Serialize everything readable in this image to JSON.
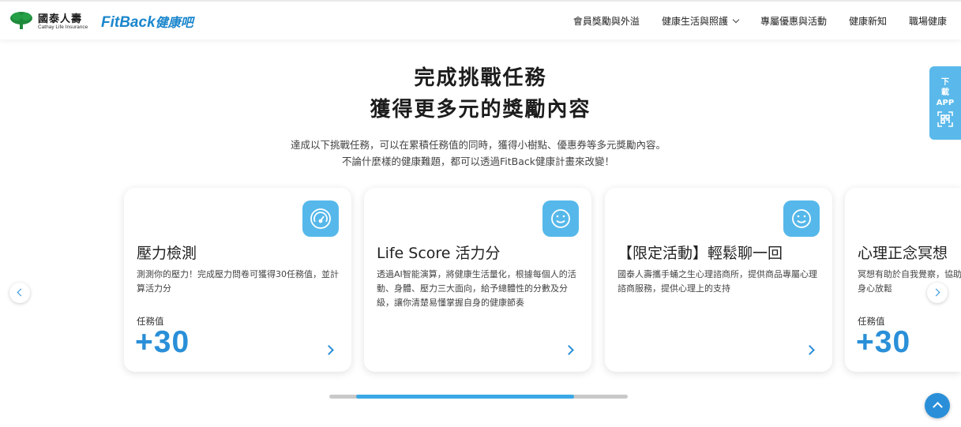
{
  "header": {
    "brand_name": "國泰人壽",
    "brand_sub": "Cathay Life Insurance",
    "fitback_en": "FitBack",
    "fitback_zh": "健康吧",
    "nav": [
      {
        "label": "會員獎勵與外溢"
      },
      {
        "label": "健康生活與照護"
      },
      {
        "label": "專屬優惠與活動"
      },
      {
        "label": "健康新知"
      },
      {
        "label": "職場健康"
      }
    ]
  },
  "hero": {
    "title_line1": "完成挑戰任務",
    "title_line2": "獲得更多元的獎勵內容",
    "desc_line1": "達成以下挑戰任務，可以在累積任務值的同時，獲得小樹點、優惠券等多元獎勵內容。",
    "desc_line2": "不論什麼樣的健康難題，都可以透過FitBack健康計畫來改變！"
  },
  "app_tab": {
    "line1": "下",
    "line2": "載",
    "line3": "APP",
    "icon": "qr-code-icon"
  },
  "cards": [
    {
      "title": "壓力檢測",
      "desc": "測測你的壓力！完成壓力問卷可獲得30任務值，並計算活力分",
      "label": "任務值",
      "value": "+30",
      "icon": "gauge-icon"
    },
    {
      "title": "Life Score 活力分",
      "desc": "透過AI智能演算，將健康生活量化，根據每個人的活動、身體、壓力三大面向，給予總體性的分數及分級，讓你清楚易懂掌握自身的健康節奏",
      "label": "",
      "value": "",
      "icon": "smiley-icon"
    },
    {
      "title": "【限定活動】輕鬆聊一回",
      "desc": "國泰人壽攜手蛹之生心理諮商所，提供商品專屬心理諮商服務，提供心理上的支持",
      "label": "",
      "value": "",
      "icon": "smiley-icon"
    },
    {
      "title": "心理正念冥想",
      "desc": "冥想有助於自我覺察，協助調節情緒，並提供方法讓身心放鬆",
      "label": "任務值",
      "value": "+30",
      "icon": "meditation-icon"
    }
  ],
  "carousel": {
    "progress_start": 0.09,
    "progress_end": 0.82
  },
  "colors": {
    "accent": "#2a8fd8",
    "icon_bg": "#56b8ea",
    "app_tab": "#5ab9ea"
  }
}
